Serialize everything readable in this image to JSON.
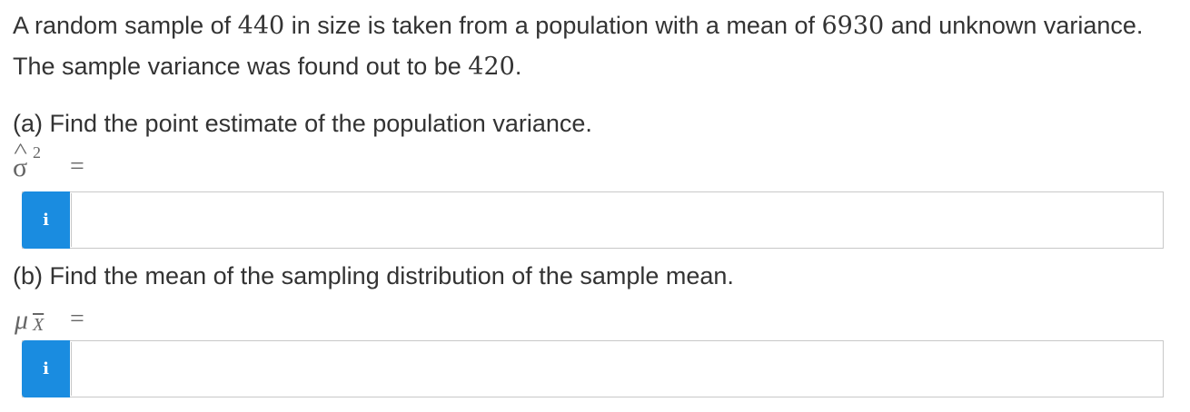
{
  "problem": {
    "text_1": "A random sample of ",
    "sample_size": "440",
    "text_2": " in size is taken from a population with a mean of ",
    "population_mean": "6930",
    "text_3": " and unknown variance. The sample variance was found out to be ",
    "sample_variance": "420",
    "text_4": "."
  },
  "part_a": {
    "label": "(a) Find the point estimate of the population variance.",
    "symbol": "σ",
    "hat": "^",
    "superscript": "2",
    "equals": "=",
    "info_icon": "i",
    "input_value": ""
  },
  "part_b": {
    "label": "(b) Find the mean of the sampling distribution of the sample mean.",
    "symbol": "μ",
    "subscript": "X",
    "equals": "=",
    "info_icon": "i",
    "input_value": ""
  }
}
